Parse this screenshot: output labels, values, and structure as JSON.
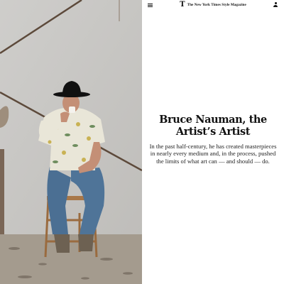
{
  "header": {
    "brand_mark": "T",
    "brand_name": "The New York Times Style Magazine",
    "menu_icon": "hamburger-menu-icon",
    "account_icon": "user-icon"
  },
  "article": {
    "headline": "Bruce Nauman, the Artist’s Artist",
    "dek": "In the past half-century, he has created masterpieces in nearly every medium and, in the process, pushed the limits of what art can — and should — do."
  },
  "photo": {
    "subject": "man in black cowboy hat and floral shirt sitting on a wooden chair drinking from a cup"
  },
  "colors": {
    "wall": "#c9c7c4",
    "floor": "#a39a8c",
    "text": "#111111",
    "background": "#ffffff"
  }
}
